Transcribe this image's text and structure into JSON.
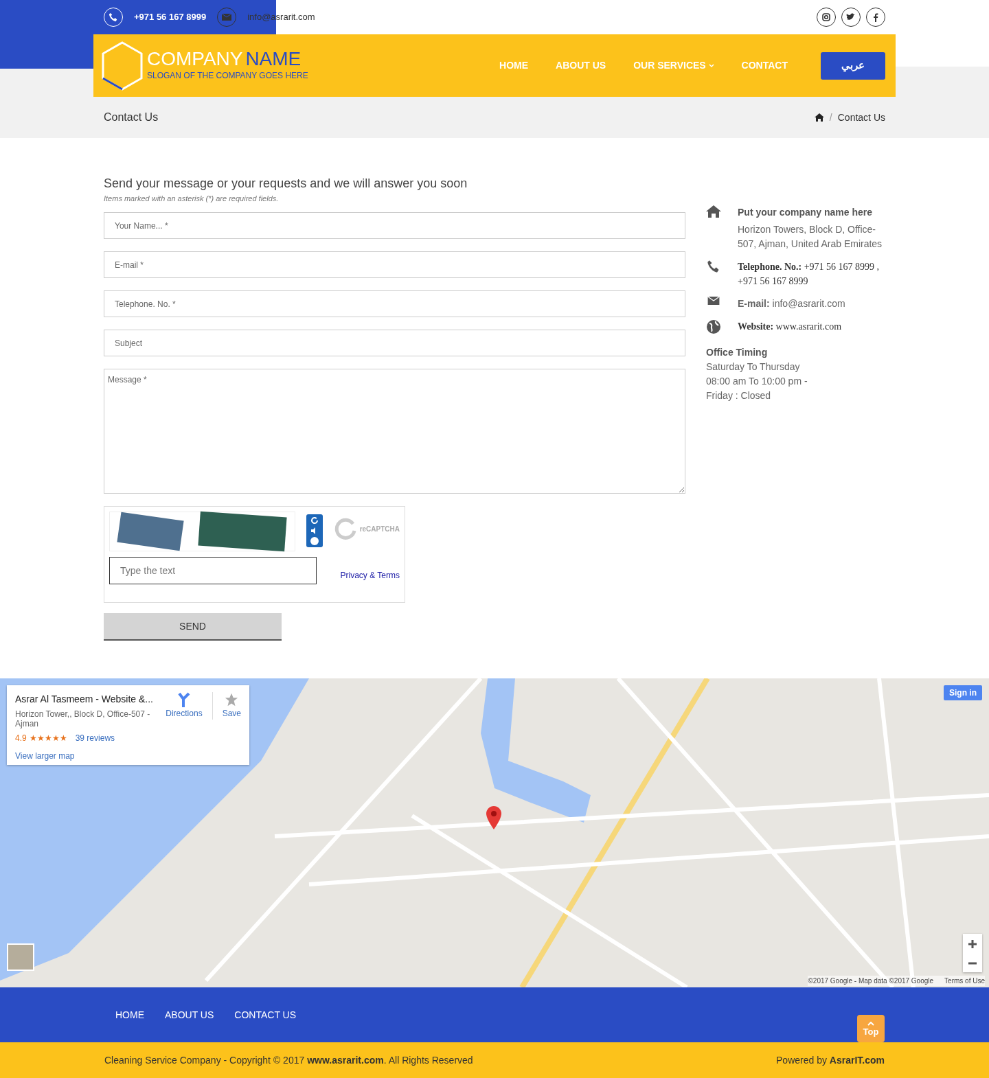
{
  "top_bar": {
    "phone": "+971 56 167 8999",
    "email": "info@asrarit.com",
    "social": [
      {
        "kind": "instagram"
      },
      {
        "kind": "twitter"
      },
      {
        "kind": "facebook"
      }
    ]
  },
  "header": {
    "logo_word_1": "COMPANY",
    "logo_word_2": "NAME",
    "slogan": "SLOGAN OF THE COMPANY GOES HERE",
    "nav": [
      {
        "label": "HOME",
        "dropdown": false
      },
      {
        "label": "ABOUT US",
        "dropdown": false
      },
      {
        "label": "OUR SERVICES",
        "dropdown": true
      },
      {
        "label": "CONTACT",
        "dropdown": false
      }
    ],
    "language_button": "عربي"
  },
  "page_title": "Contact Us",
  "breadcrumb_separator": "/",
  "breadcrumb": [
    "Contact Us"
  ],
  "form": {
    "heading": "Send your message or your requests and we will answer you soon",
    "note": "Items marked with an asterisk (*) are required fields.",
    "fields": [
      {
        "kind": "input",
        "placeholder": "Your Name... *"
      },
      {
        "kind": "input",
        "placeholder": "E-mail *"
      },
      {
        "kind": "input",
        "placeholder": "Telephone. No. *"
      },
      {
        "kind": "input",
        "placeholder": "Subject"
      },
      {
        "kind": "textarea",
        "placeholder": "Message *"
      }
    ],
    "captcha": {
      "placeholder": "Type the text",
      "logo": "reCAPTCHA",
      "link": "Privacy & Terms"
    },
    "submit": "SEND"
  },
  "contact": {
    "items": [
      {
        "kind": "home",
        "title": "Put your company name here",
        "text": "Horizon Towers, Block D, Office-507, Ajman, United Arab Emirates"
      },
      {
        "kind": "phone",
        "label": "Telephone. No.:",
        "text": "+971 56 167 8999 , +971 56 167 8999"
      },
      {
        "kind": "email",
        "label": "E-mail:",
        "text": "info@asrarit.com"
      },
      {
        "kind": "globe",
        "label": "Website:",
        "text": "www.asrarit.com"
      }
    ],
    "timing_title": "Office Timing",
    "timing": [
      "Saturday To Thursday",
      "08:00 am To 10:00 pm -",
      "Friday : Closed"
    ]
  },
  "map": {
    "card": {
      "title": "Asrar Al Tasmeem - Website &...",
      "address": "Horizon Tower,, Block D, Office-507 - Ajman",
      "rating": "4.9",
      "stars": 5,
      "reviews": "39 reviews",
      "directions": "Directions",
      "save": "Save",
      "larger": "View larger map"
    },
    "sign_in": "Sign in",
    "copyright": "©2017 Google - Map data ©2017 Google",
    "terms": "Terms of Use"
  },
  "footer": {
    "nav": [
      "HOME",
      "ABOUT US",
      "CONTACT US"
    ],
    "top_button": "Top",
    "copyright": "Cleaning Service Company - Copyright © 2017 **www.asrarit.com**. All Rights Reserved",
    "powered": "Powered by **AsrarIT.com**"
  }
}
